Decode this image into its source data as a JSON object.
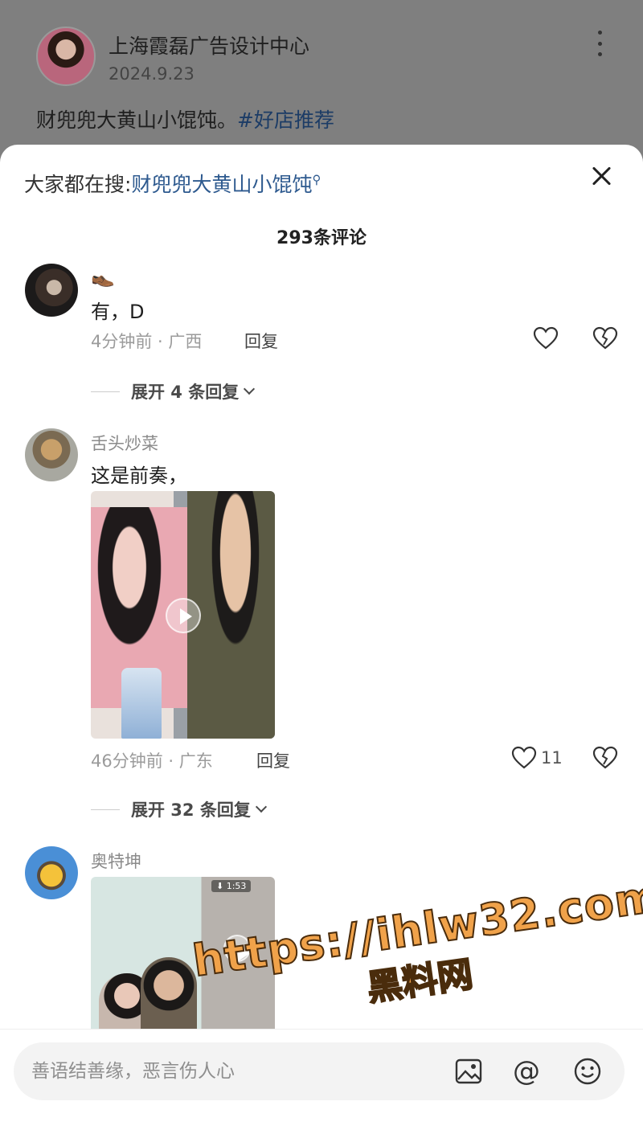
{
  "post": {
    "author": "上海霞磊广告设计中心",
    "date": "2024.9.23",
    "text": "财兜兜大黄山小馄饨。",
    "hashtag": "#好店推荐"
  },
  "sheet": {
    "search_prefix": "大家都在搜:",
    "search_term": "财兜兜大黄山小馄饨",
    "comment_count": "293条评论"
  },
  "comments": [
    {
      "name": "👞",
      "text": "有，D",
      "meta": "4分钟前 · 广西",
      "reply_label": "回复",
      "likes": "",
      "expand_label": "展开 4 条回复"
    },
    {
      "name": "舌头炒菜",
      "text": "这是前奏，",
      "meta": "46分钟前 · 广东",
      "reply_label": "回复",
      "likes": "11",
      "expand_label": "展开 32 条回复"
    },
    {
      "name": "奥特坤",
      "text": "",
      "media_badge": "⬇ 1:53"
    }
  ],
  "input": {
    "placeholder": "善语结善缘，恶言伤人心"
  },
  "watermark": {
    "url": "https://ihlw32.com",
    "name": "黑料网"
  },
  "icons": {
    "more": "more-vertical-icon",
    "close": "close-icon",
    "search": "search-icon",
    "like": "heart-icon",
    "dislike": "broken-heart-icon",
    "image": "image-icon",
    "mention": "at-icon",
    "emoji": "emoji-icon"
  },
  "colors": {
    "link": "#2e5a8f",
    "overlay": "#7f7f7f",
    "watermark": "#f0a24a"
  }
}
